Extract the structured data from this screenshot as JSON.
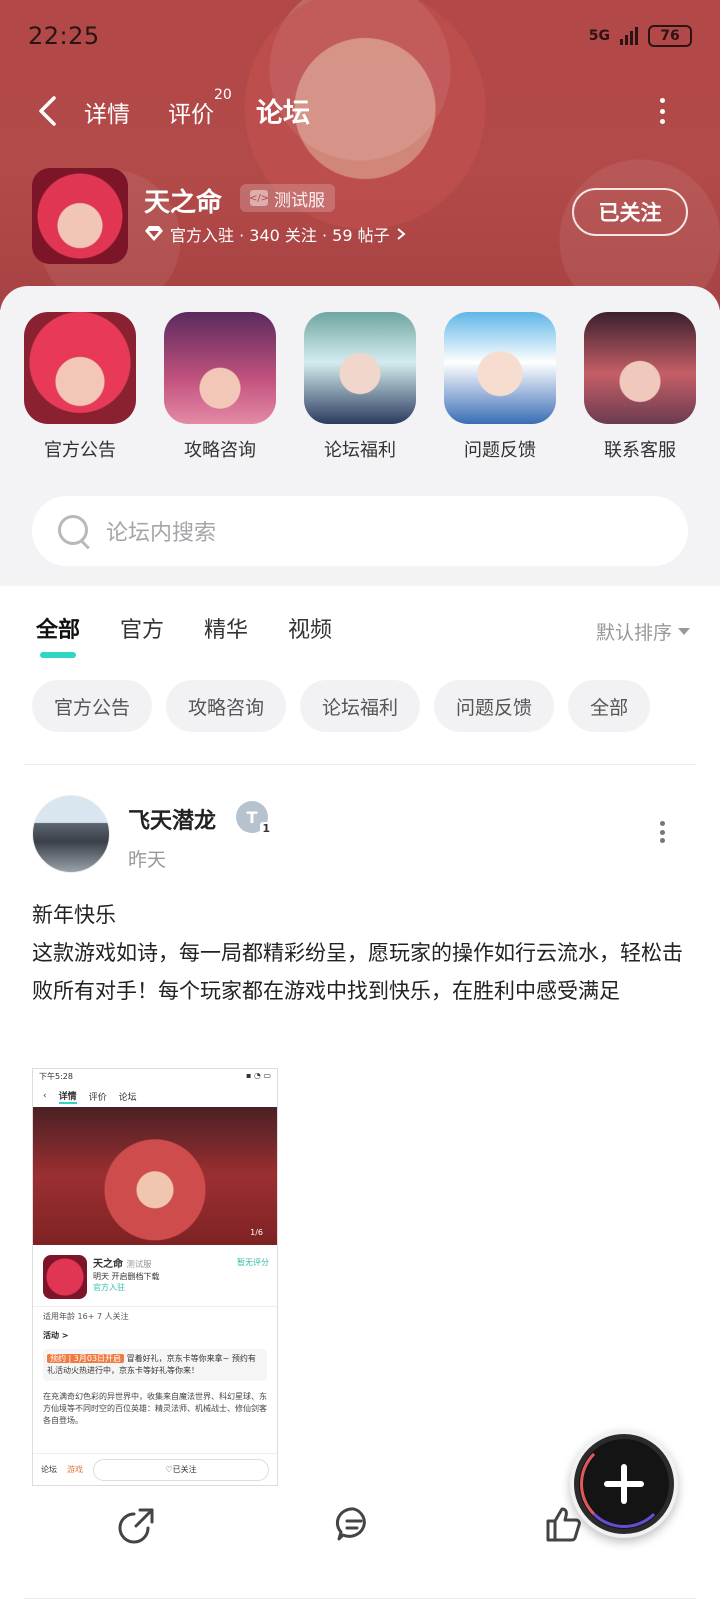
{
  "status_bar": {
    "time": "22:25",
    "network": "5G",
    "battery": "76"
  },
  "nav": {
    "tabs": [
      {
        "label": "详情"
      },
      {
        "label": "评价",
        "badge": "20"
      },
      {
        "label": "论坛"
      }
    ],
    "active_tab": "论坛"
  },
  "game": {
    "name": "天之命",
    "test_badge": "测试服",
    "meta": "官方入驻 · 340 关注 · 59 帖子",
    "follow_label": "已关注"
  },
  "shortcuts": [
    {
      "label": "官方公告"
    },
    {
      "label": "攻略咨询"
    },
    {
      "label": "论坛福利"
    },
    {
      "label": "问题反馈"
    },
    {
      "label": "联系客服"
    }
  ],
  "search": {
    "placeholder": "论坛内搜索"
  },
  "filter_tabs": [
    {
      "label": "全部"
    },
    {
      "label": "官方"
    },
    {
      "label": "精华"
    },
    {
      "label": "视频"
    }
  ],
  "sort_label": "默认排序",
  "chips": [
    {
      "label": "官方公告"
    },
    {
      "label": "攻略咨询"
    },
    {
      "label": "论坛福利"
    },
    {
      "label": "问题反馈"
    },
    {
      "label": "全部"
    }
  ],
  "post": {
    "username": "飞天潜龙",
    "level_sub": "1",
    "time": "昨天",
    "title": "新年快乐",
    "body": "这款游戏如诗，每一局都精彩纷呈，愿玩家的操作如行云流水，轻松击败所有对手！每个玩家都在游戏中找到快乐，在胜利中感受满足",
    "image": {
      "status_time": "下午5:28",
      "nav": [
        "详情",
        "评价",
        "论坛"
      ],
      "counter": "1/6",
      "game_name": "天之命",
      "game_badge": "测试服",
      "game_sub": "明天 开启删档下载",
      "official": "官方入驻",
      "rate": "暂无评分",
      "stats": "适用年龄 16+   7 人关注",
      "event_header": "活动 >",
      "event_tag": "预约 | 3月03日开启",
      "event_text": "冒着好礼，京东卡等你来拿~ 预约有礼活动火热进行中，京东卡等好礼等你来！",
      "desc": "在充满奇幻色彩的异世界中，收集来自魔法世界、科幻星球、东方仙境等不同时空的百位英雄：精灵法师、机械战士、修仙剑客各自登场。",
      "foot_left": "论坛",
      "foot_mid": "游戏",
      "foot_follow": "已关注"
    }
  },
  "icons": {
    "back": "back-arrow-icon",
    "more": "more-vertical-icon",
    "search": "search-icon",
    "share": "share-icon",
    "comment": "comment-icon",
    "like": "thumbs-up-icon",
    "fab": "plus-icon"
  },
  "colors": {
    "accent": "#2fd6c2",
    "hero": "#b24848"
  }
}
